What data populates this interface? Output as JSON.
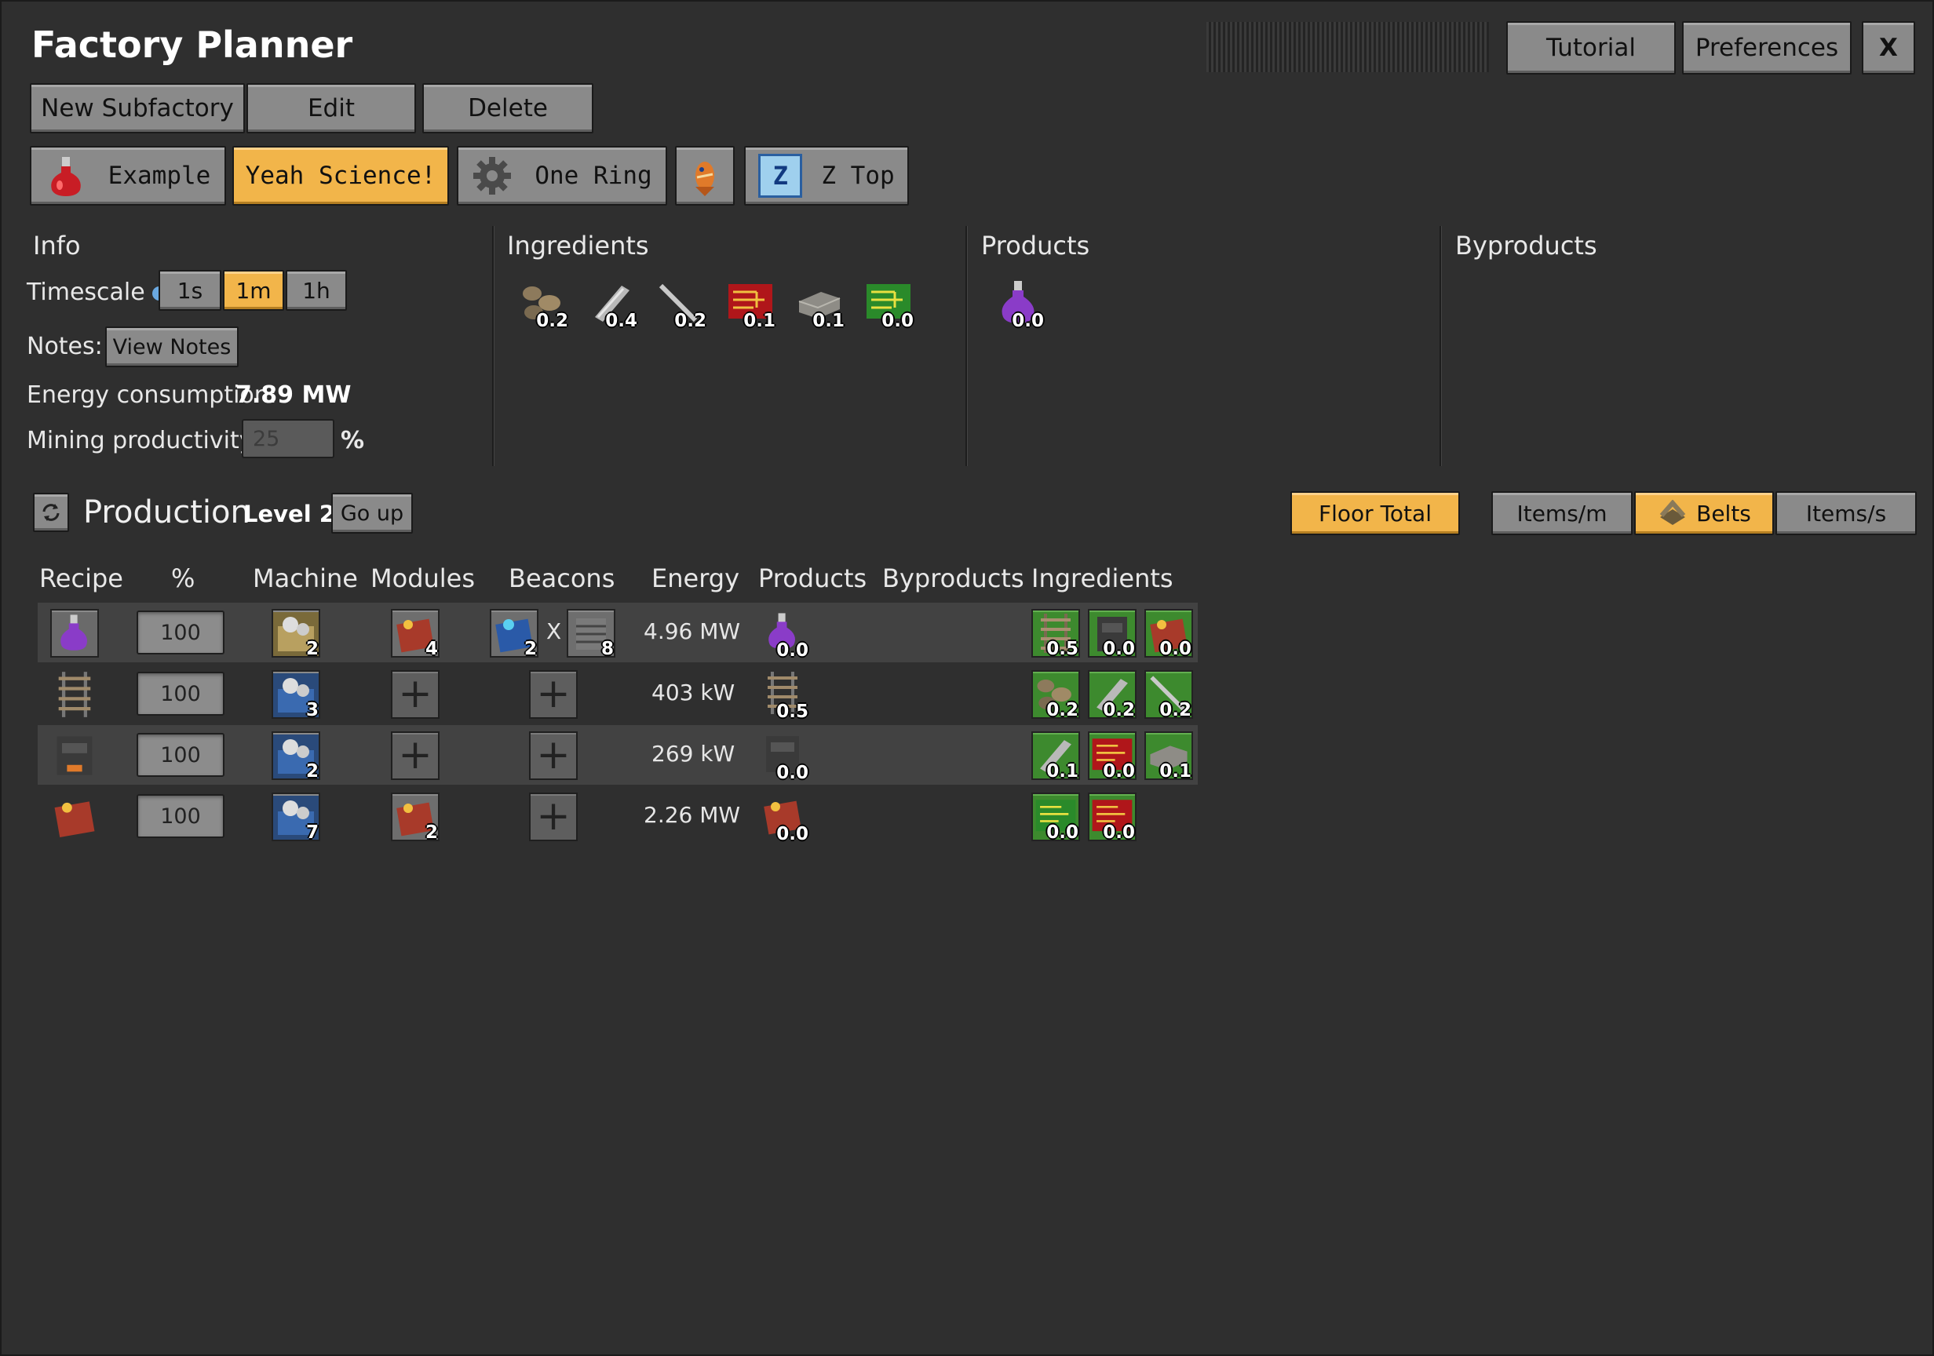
{
  "window": {
    "title": "Factory Planner",
    "tutorial_label": "Tutorial",
    "preferences_label": "Preferences",
    "close_label": "X"
  },
  "actions": {
    "new_label": "New Subfactory",
    "edit_label": "Edit",
    "delete_label": "Delete"
  },
  "subfactories": [
    {
      "label": "Example",
      "icon": "red-flask-icon",
      "selected": false
    },
    {
      "label": "Yeah Science!",
      "icon": "",
      "selected": true
    },
    {
      "label": "One Ring",
      "icon": "gear-icon",
      "selected": false
    },
    {
      "label": "",
      "icon": "fish-icon",
      "selected": false
    },
    {
      "label": "Z Top",
      "icon": "z-letter-icon",
      "icon_text": "Z",
      "selected": false
    }
  ],
  "info": {
    "heading": "Info",
    "timescale_label": "Timescale",
    "timescale_options": [
      "1s",
      "1m",
      "1h"
    ],
    "timescale_selected": "1m",
    "notes_label": "Notes:",
    "view_notes_label": "View Notes",
    "energy_label": "Energy consumption:",
    "energy_value": "7.89 MW",
    "mining_label": "Mining productivity",
    "mining_value": "25",
    "mining_unit": "%"
  },
  "ingredients": {
    "heading": "Ingredients",
    "items": [
      {
        "icon": "stone-ore-icon",
        "count": "0.2"
      },
      {
        "icon": "iron-stick-icon",
        "count": "0.4"
      },
      {
        "icon": "steel-rod-icon",
        "count": "0.2"
      },
      {
        "icon": "red-circuit-icon",
        "count": "0.1"
      },
      {
        "icon": "stone-brick-icon",
        "count": "0.1"
      },
      {
        "icon": "green-circuit-icon",
        "count": "0.0"
      }
    ]
  },
  "products": {
    "heading": "Products",
    "items": [
      {
        "icon": "purple-flask-icon",
        "count": "0.0"
      }
    ]
  },
  "byproducts": {
    "heading": "Byproducts"
  },
  "production": {
    "title": "Production",
    "level": "Level 2",
    "go_up_label": "Go up",
    "floor_total_label": "Floor Total",
    "units": [
      "Items/m",
      "Belts",
      "Items/s"
    ],
    "unit_selected": "Belts",
    "columns": [
      "Recipe",
      "%",
      "Machine",
      "Modules",
      "Beacons",
      "Energy",
      "Products",
      "Byproducts",
      "Ingredients"
    ],
    "rows": [
      {
        "recipe_icon": "purple-flask-icon",
        "percent": "100",
        "machine_count": "2",
        "module_count": "4",
        "beacon_count": "2",
        "beacon_x": "X",
        "beacon_module_count": "8",
        "energy": "4.96 MW",
        "product_count": "0.0",
        "ingredients": [
          "0.5",
          "0.0",
          "0.0"
        ]
      },
      {
        "recipe_icon": "rail-icon",
        "percent": "100",
        "machine_count": "3",
        "energy": "403 kW",
        "product_count": "0.5",
        "ingredients": [
          "0.2",
          "0.2",
          "0.2"
        ]
      },
      {
        "recipe_icon": "furnace-block-icon",
        "percent": "100",
        "machine_count": "2",
        "energy": "269 kW",
        "product_count": "0.0",
        "ingredients": [
          "0.1",
          "0.0",
          "0.1"
        ]
      },
      {
        "recipe_icon": "productivity-module-icon",
        "percent": "100",
        "machine_count": "7",
        "module_count": "2",
        "energy": "2.26 MW",
        "product_count": "0.0",
        "ingredients": [
          "0.0",
          "0.0"
        ]
      }
    ]
  },
  "colors": {
    "accent": "#f2b54a",
    "panel": "#2f2f2f",
    "button": "#8a8a8a",
    "slot_green": "#3d8a2e"
  }
}
